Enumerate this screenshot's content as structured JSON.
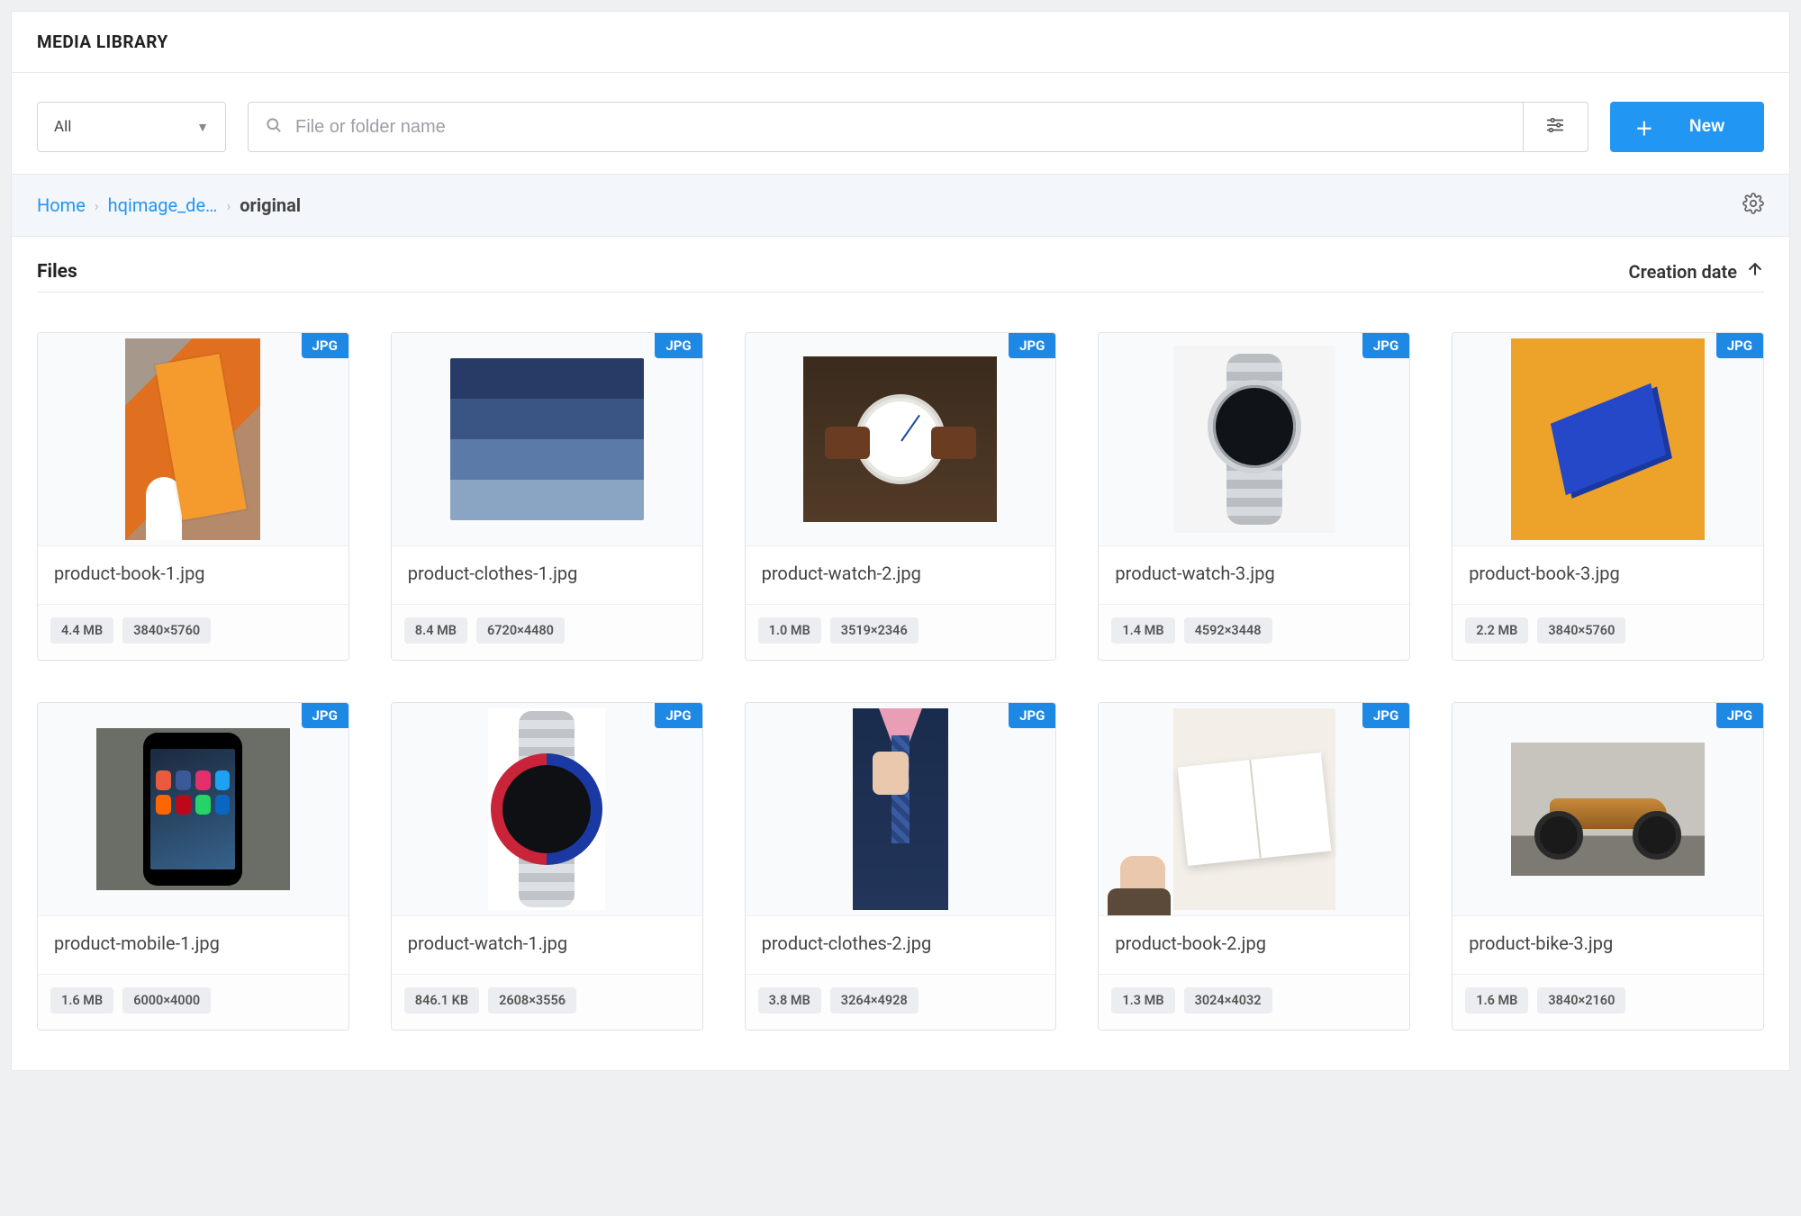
{
  "title": "MEDIA LIBRARY",
  "toolbar": {
    "filter_value": "All",
    "search_placeholder": "File or folder name",
    "new_label": "New"
  },
  "breadcrumb": {
    "items": [
      "Home",
      "hqimage_de…",
      "original"
    ]
  },
  "list": {
    "heading": "Files",
    "sort_label": "Creation date",
    "sort_direction": "asc"
  },
  "files": [
    {
      "name": "product-book-1.jpg",
      "ext": "JPG",
      "size": "4.4 MB",
      "dimensions": "3840×5760",
      "thumb": "book1"
    },
    {
      "name": "product-clothes-1.jpg",
      "ext": "JPG",
      "size": "8.4 MB",
      "dimensions": "6720×4480",
      "thumb": "jeans"
    },
    {
      "name": "product-watch-2.jpg",
      "ext": "JPG",
      "size": "1.0 MB",
      "dimensions": "3519×2346",
      "thumb": "watch2"
    },
    {
      "name": "product-watch-3.jpg",
      "ext": "JPG",
      "size": "1.4 MB",
      "dimensions": "4592×3448",
      "thumb": "watch3"
    },
    {
      "name": "product-book-3.jpg",
      "ext": "JPG",
      "size": "2.2 MB",
      "dimensions": "3840×5760",
      "thumb": "book3"
    },
    {
      "name": "product-mobile-1.jpg",
      "ext": "JPG",
      "size": "1.6 MB",
      "dimensions": "6000×4000",
      "thumb": "mobile"
    },
    {
      "name": "product-watch-1.jpg",
      "ext": "JPG",
      "size": "846.1 KB",
      "dimensions": "2608×3556",
      "thumb": "watch1"
    },
    {
      "name": "product-clothes-2.jpg",
      "ext": "JPG",
      "size": "3.8 MB",
      "dimensions": "3264×4928",
      "thumb": "clothes2"
    },
    {
      "name": "product-book-2.jpg",
      "ext": "JPG",
      "size": "1.3 MB",
      "dimensions": "3024×4032",
      "thumb": "book2"
    },
    {
      "name": "product-bike-3.jpg",
      "ext": "JPG",
      "size": "1.6 MB",
      "dimensions": "3840×2160",
      "thumb": "bike"
    }
  ]
}
